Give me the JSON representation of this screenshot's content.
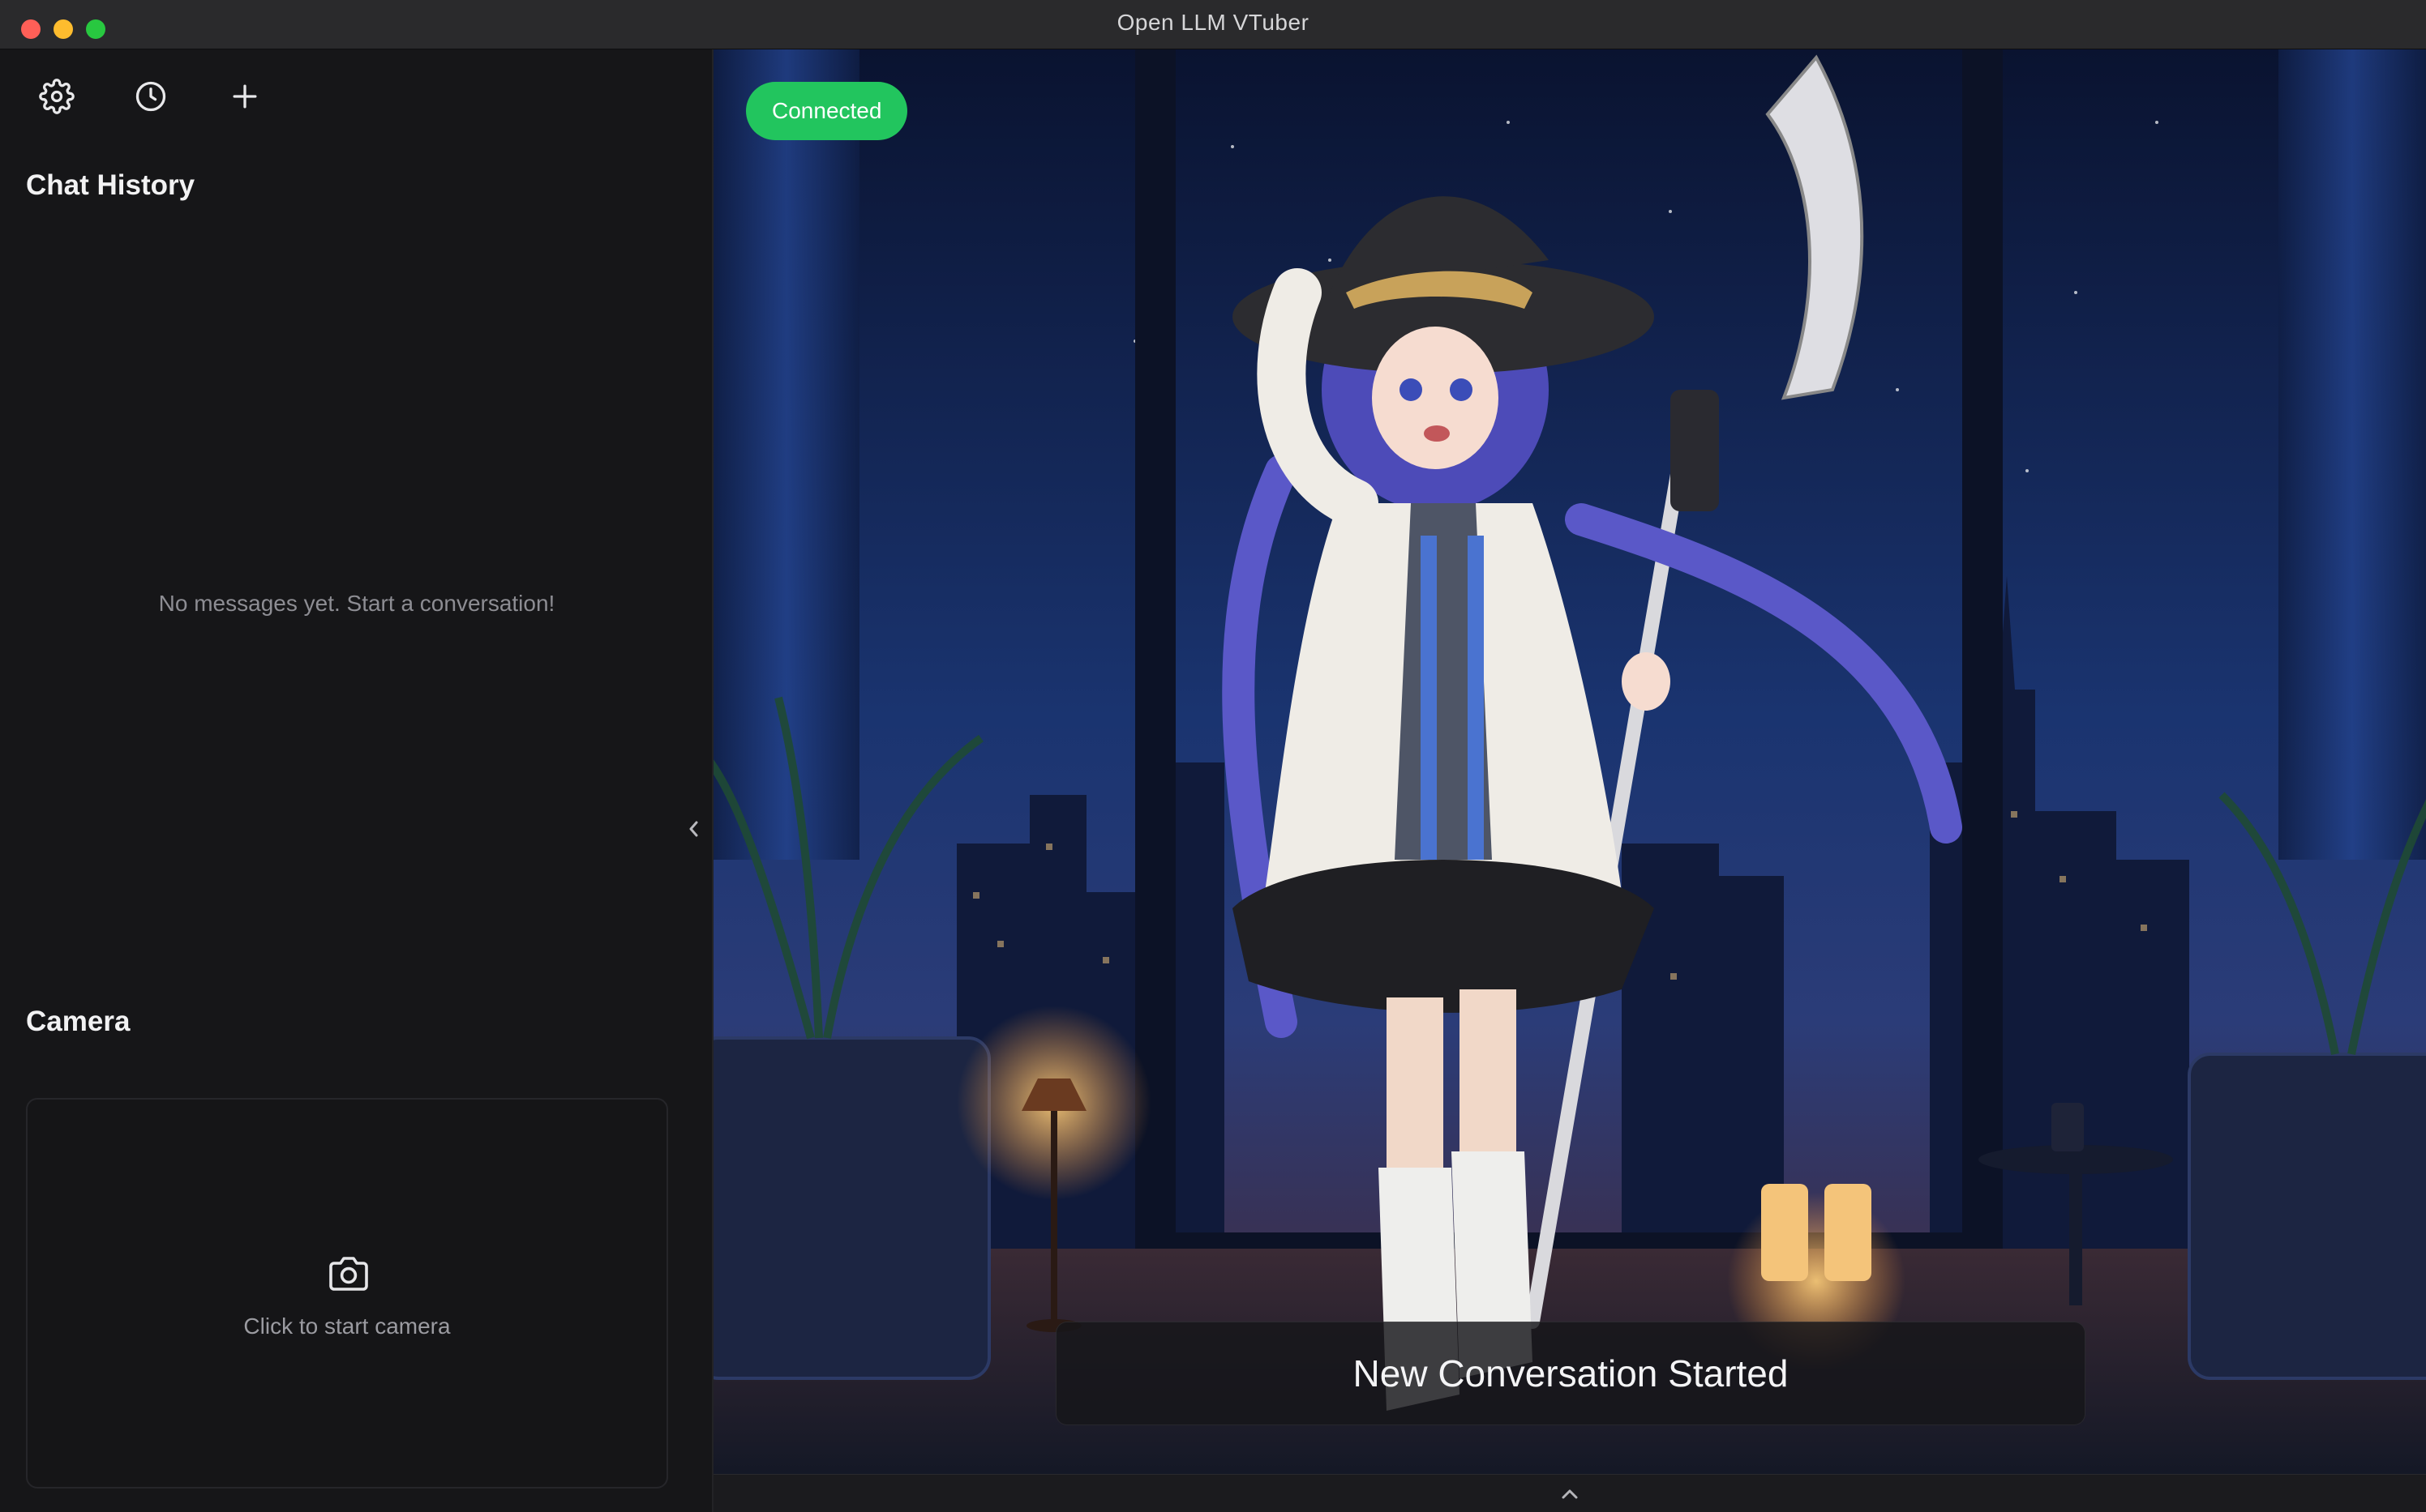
{
  "window": {
    "title": "Open LLM VTuber"
  },
  "sidebar": {
    "toolbar": {
      "settings_icon": "gear-icon",
      "history_icon": "clock-icon",
      "new_chat_icon": "plus-icon"
    },
    "chat_history": {
      "title": "Chat History",
      "empty_message": "No messages yet. Start a conversation!"
    },
    "camera": {
      "title": "Camera",
      "icon": "camera-icon",
      "prompt": "Click to start camera"
    },
    "collapse_icon": "chevron-left-icon"
  },
  "stage": {
    "status": "Connected",
    "status_color": "#22c55e",
    "subtitle": "New Conversation Started",
    "background": "night-city-room-scene",
    "character": "anime-witch-vtuber-model"
  },
  "bottombar": {
    "expand_icon": "chevron-up-icon"
  }
}
